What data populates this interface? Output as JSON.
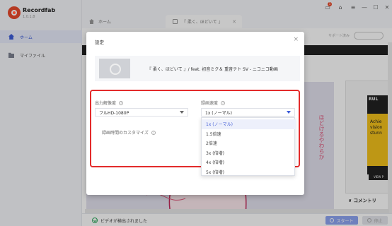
{
  "app": {
    "name": "Recordfab",
    "version": "1.0.1.8"
  },
  "sidebar": {
    "items": [
      {
        "label": "ホーム",
        "icon": "home-icon",
        "active": true
      },
      {
        "label": "マイファイル",
        "icon": "folder-icon",
        "active": false
      }
    ]
  },
  "tabs": [
    {
      "label": "ホーム",
      "icon": "home-icon"
    },
    {
      "label": "『 柔く、ほどいて 』",
      "icon": "page-icon",
      "closable": true
    }
  ],
  "window_controls": {
    "notify_badge": "1",
    "min": "—",
    "max": "☐",
    "close": "✕"
  },
  "main": {
    "support_text": "サポート済み",
    "vertical_text": "ほどけるやわらか",
    "ad": {
      "brand": "RUL",
      "headline": "Achie vision stunn",
      "cta": "VIEW P"
    },
    "comments_label": "コメントリ"
  },
  "modal": {
    "title": "設定",
    "video_title": "『 柔く、ほどいて 』/ feat. 初音ミク＆ 重音テト SV - ニコニコ動画",
    "resolution": {
      "label": "出力解像度",
      "value": "フルHD-1080P"
    },
    "speed": {
      "label": "録画速度",
      "value": "1x (ノーマル)",
      "options": [
        "1x (ノーマル)",
        "1.5倍速",
        "2倍速",
        "3x (倍増)",
        "4x (倍増)",
        "5x (倍増)"
      ],
      "selected_index": 0
    },
    "custom_time": {
      "label": "録画時間のカスタマイズ"
    }
  },
  "statusbar": {
    "status_text": "ビデオが検出されました",
    "start_label": "スタート",
    "stop_label": "停止"
  },
  "colors": {
    "accent": "#3c5bd9",
    "highlight_border": "#e32b2b",
    "brand": "#e84a2c"
  }
}
